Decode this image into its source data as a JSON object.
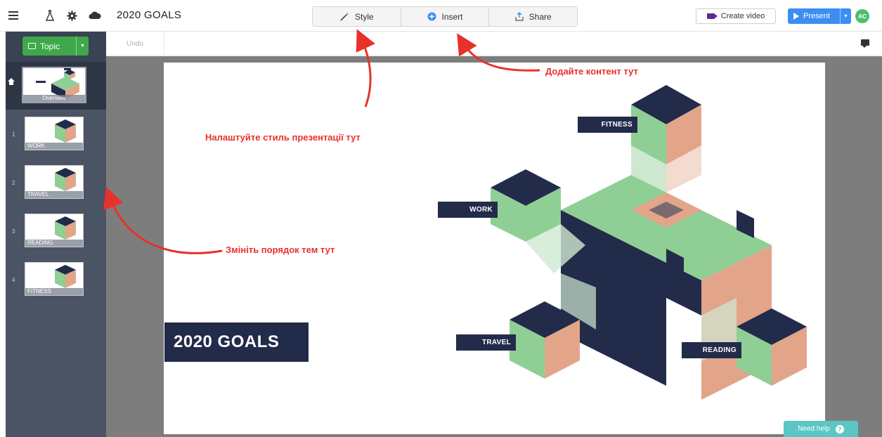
{
  "app": {
    "doc_title": "2020 GOALS",
    "icons": [
      "menu-icon",
      "flask-icon",
      "settings-icon",
      "cloud-icon"
    ]
  },
  "toolbar": {
    "style_label": "Style",
    "insert_label": "Insert",
    "share_label": "Share",
    "create_video_label": "Create video",
    "present_label": "Present",
    "avatar_initials": "AC"
  },
  "sidebar": {
    "topic_label": "Topic",
    "overview_label": "Overview",
    "slides": [
      {
        "num": "1",
        "label": "WORK"
      },
      {
        "num": "2",
        "label": "TRAVEL"
      },
      {
        "num": "3",
        "label": "READING"
      },
      {
        "num": "4",
        "label": "FITNESS"
      }
    ]
  },
  "editor": {
    "undo_label": "Undo"
  },
  "slide": {
    "title": "2020 GOALS",
    "tags": {
      "fitness": "FITNESS",
      "work": "WORK",
      "travel": "TRAVEL",
      "reading": "READING"
    }
  },
  "annotations": {
    "insert_note": "Додайте контент тут",
    "style_note": "Налаштуйте стиль презентації тут",
    "order_note": "Змініть порядок тем тут"
  },
  "help": {
    "label": "Need help"
  },
  "colors": {
    "accent_blue": "#3c8ef3",
    "topic_green": "#3fa84a",
    "navy": "#232b4a",
    "mint": "#8fcf95",
    "salmon": "#e2a589",
    "annotation_red": "#e8312a",
    "help_teal": "#5bc6c4"
  }
}
